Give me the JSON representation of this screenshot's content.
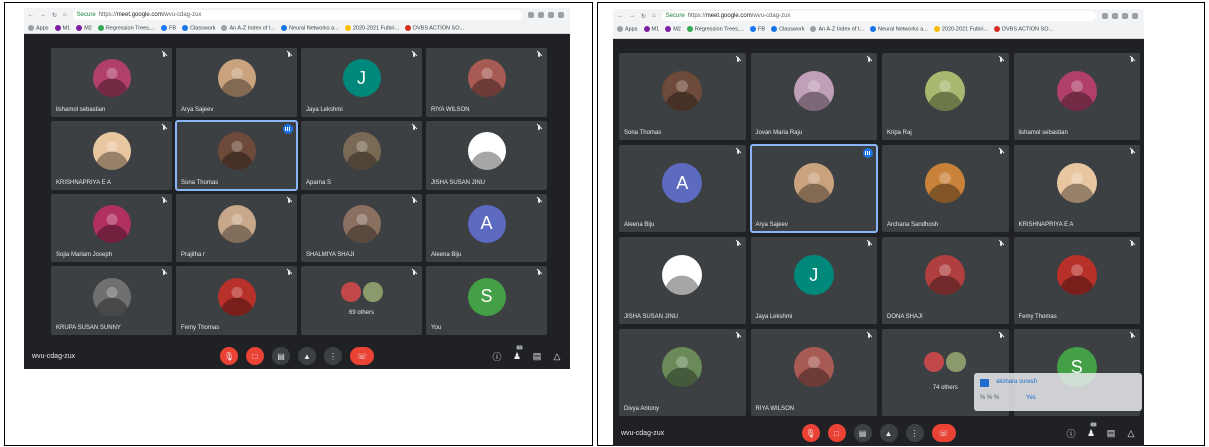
{
  "left": {
    "browser": {
      "secure": "Secure",
      "url_prefix": "https://",
      "url_host": "meet.google.com",
      "url_path": "/wvu-cdag-zux",
      "bookmarks": [
        "Apps",
        "M1",
        "M2",
        "Regression Trees,...",
        "FB",
        "Classwork",
        "An A-Z Index of t...",
        "Neural Networks a...",
        "2020-2021 Fulbri...",
        "DVBS ACTION SO..."
      ]
    },
    "tiles": [
      {
        "name": "lishamol sebastian",
        "kind": "photo",
        "color": "#b0406a"
      },
      {
        "name": "Arya Sajeev",
        "kind": "photo",
        "color": "#c9a27e"
      },
      {
        "name": "Jaya Lekshmi",
        "kind": "letter",
        "letter": "J",
        "color": "#00897b"
      },
      {
        "name": "RIYA WILSON",
        "kind": "photo",
        "color": "#a85b54"
      },
      {
        "name": "KRISHNAPRIYA E A",
        "kind": "photo",
        "color": "#e8c6a0"
      },
      {
        "name": "Sona Thomas",
        "kind": "photo",
        "color": "#6d4a3a",
        "active": true
      },
      {
        "name": "Aparna S",
        "kind": "photo",
        "color": "#7a6a55"
      },
      {
        "name": "JISHA SUSAN JINU",
        "kind": "photo",
        "color": "#ffffff"
      },
      {
        "name": "Sojia Mariam Joseph",
        "kind": "photo",
        "color": "#b03060"
      },
      {
        "name": "Prajitha r",
        "kind": "photo",
        "color": "#c8a88a"
      },
      {
        "name": "SHALMIYA SHAJI",
        "kind": "photo",
        "color": "#8a7060"
      },
      {
        "name": "Aleena Biju",
        "kind": "letter",
        "letter": "A",
        "color": "#5c6bc0"
      },
      {
        "name": "KRUPA SUSAN SUNNY",
        "kind": "photo",
        "color": "#707070"
      },
      {
        "name": "Femy Thomas",
        "kind": "photo",
        "color": "#b8302a"
      },
      {
        "name": "",
        "kind": "others",
        "count_text": "69 others"
      },
      {
        "name": "You",
        "kind": "letter",
        "letter": "S",
        "color": "#43a047"
      }
    ],
    "meeting_code": "wvu-cdag-zux",
    "people_badge": "84"
  },
  "right": {
    "browser": {
      "secure": "Secure",
      "url_prefix": "https://",
      "url_host": "meet.google.com",
      "url_path": "/wvu-cdag-zux",
      "bookmarks": [
        "Apps",
        "M1",
        "M2",
        "Regression Trees,...",
        "FB",
        "Classwork",
        "An A-Z Index of t...",
        "Neural Networks a...",
        "2020-2021 Fulbri...",
        "DVBS ACTION SO..."
      ]
    },
    "tiles": [
      {
        "name": "Sona Thomas",
        "kind": "photo",
        "color": "#6d4a3a"
      },
      {
        "name": "Jovan Maria Raju",
        "kind": "photo",
        "color": "#c0a0b8"
      },
      {
        "name": "Kripa Raj",
        "kind": "photo",
        "color": "#a8b870"
      },
      {
        "name": "lishamol sebastian",
        "kind": "photo",
        "color": "#b0406a"
      },
      {
        "name": "Aleena Biju",
        "kind": "letter",
        "letter": "A",
        "color": "#5c6bc0"
      },
      {
        "name": "Arya Sajeev",
        "kind": "photo",
        "color": "#c9a27e",
        "active": true
      },
      {
        "name": "Archana Sandhosh",
        "kind": "photo",
        "color": "#c8823a"
      },
      {
        "name": "KRISHNAPRIYA E A",
        "kind": "photo",
        "color": "#e8c6a0"
      },
      {
        "name": "JISHA SUSAN JINU",
        "kind": "photo",
        "color": "#ffffff"
      },
      {
        "name": "Jaya Lekshmi",
        "kind": "letter",
        "letter": "J",
        "color": "#00897b"
      },
      {
        "name": "DONA SHAJI",
        "kind": "photo",
        "color": "#b04040"
      },
      {
        "name": "Femy Thomas",
        "kind": "photo",
        "color": "#b8302a"
      },
      {
        "name": "Divya Antony",
        "kind": "photo",
        "color": "#6a8a5a"
      },
      {
        "name": "RIYA WILSON",
        "kind": "photo",
        "color": "#a85b54"
      },
      {
        "name": "",
        "kind": "others",
        "count_text": "74 others"
      },
      {
        "name": "",
        "kind": "letter",
        "letter": "S",
        "color": "#43a047"
      }
    ],
    "meeting_code": "wvu-cdag-zux",
    "people_badge": "89",
    "toast": {
      "sender": "akshara suresh",
      "message": "% % %",
      "highlight": "Yes"
    }
  }
}
